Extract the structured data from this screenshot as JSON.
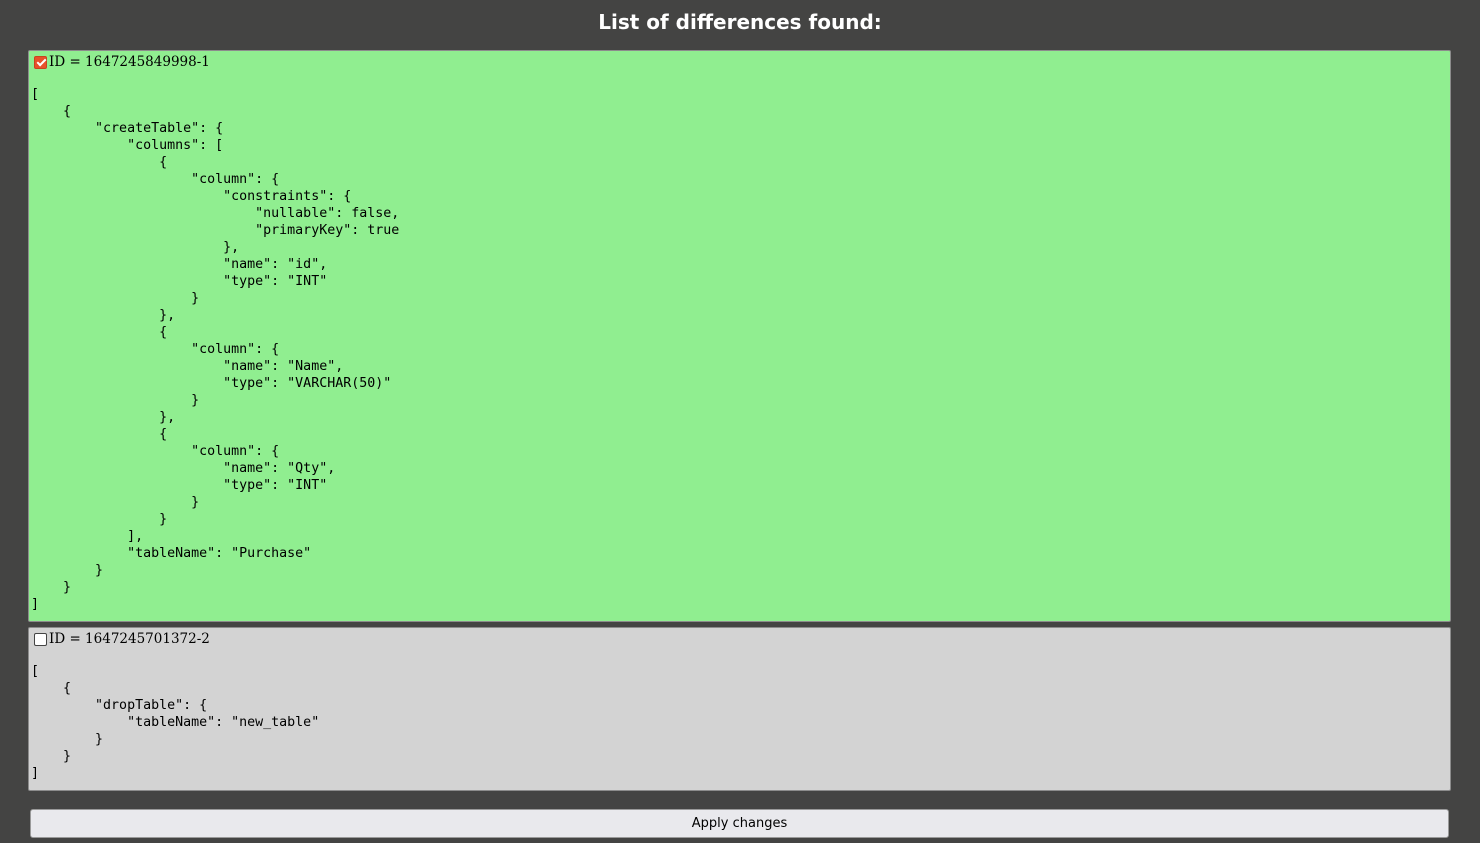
{
  "page": {
    "title": "List of differences found:"
  },
  "diffs": [
    {
      "id_label": "ID = 1647245849998-1",
      "checked": true,
      "background": "#90ee90",
      "content": "[\n    {\n        \"createTable\": {\n            \"columns\": [\n                {\n                    \"column\": {\n                        \"constraints\": {\n                            \"nullable\": false,\n                            \"primaryKey\": true\n                        },\n                        \"name\": \"id\",\n                        \"type\": \"INT\"\n                    }\n                },\n                {\n                    \"column\": {\n                        \"name\": \"Name\",\n                        \"type\": \"VARCHAR(50)\"\n                    }\n                },\n                {\n                    \"column\": {\n                        \"name\": \"Qty\",\n                        \"type\": \"INT\"\n                    }\n                }\n            ],\n            \"tableName\": \"Purchase\"\n        }\n    }\n]"
    },
    {
      "id_label": "ID = 1647245701372-2",
      "checked": false,
      "background": "#d3d3d3",
      "content": "[\n    {\n        \"dropTable\": {\n            \"tableName\": \"new_table\"\n        }\n    }\n]"
    }
  ],
  "apply_button": {
    "label": "Apply changes"
  },
  "colors": {
    "page_background": "#444443",
    "checkbox_accent": "#e8512a"
  }
}
